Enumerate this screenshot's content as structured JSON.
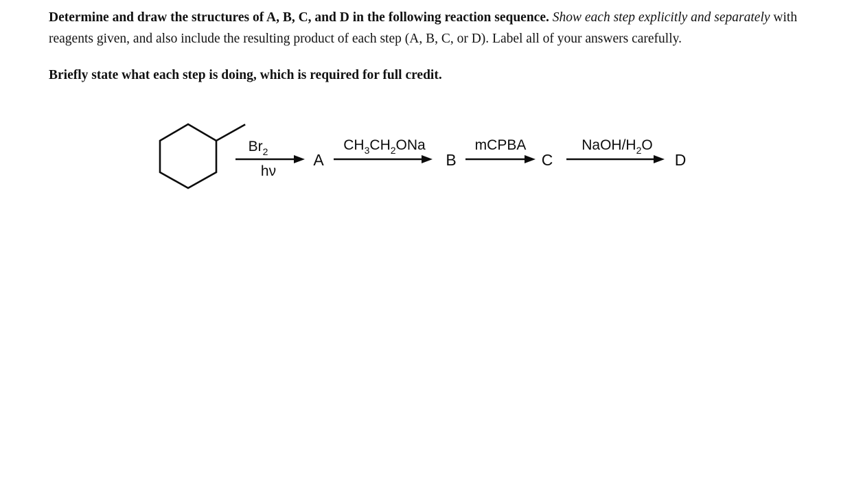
{
  "document": {
    "paragraphs": [
      {
        "id": "p1",
        "runs": [
          {
            "style": "bold",
            "text": "Determine and draw the structures of A, B, C, and D in the following reaction sequence."
          },
          {
            "style": "regular",
            "text": " "
          },
          {
            "style": "italic",
            "text": "Show each step explicitly and separately"
          },
          {
            "style": "regular",
            "text": " with reagents given, and also include the resulting product of each step (A, B, C, or D). Label all of your answers carefully."
          }
        ]
      },
      {
        "id": "p2",
        "runs": [
          {
            "style": "bold",
            "text": "Briefly state what each step is doing, which is required for full credit."
          }
        ]
      }
    ]
  },
  "scheme": {
    "structure": {
      "name": "methylcyclohexane",
      "description": "cyclohexane ring with methyl substituent"
    },
    "steps": [
      {
        "id": "step1",
        "reagent_above": "Br",
        "reagent_above_sub": "2",
        "reagent_below": "hν",
        "product_label": "A"
      },
      {
        "id": "step2",
        "reagent_above": "CH",
        "reagent_above_sub": "3",
        "reagent_above_2": "CH",
        "reagent_above_sub2": "2",
        "reagent_above_3": "ONa",
        "reagent_below": "",
        "product_label": "B"
      },
      {
        "id": "step3",
        "reagent_above": "mCPBA",
        "reagent_below": "",
        "product_label": "C"
      },
      {
        "id": "step4",
        "reagent_above": "NaOH/H",
        "reagent_above_sub": "2",
        "reagent_above_2": "O",
        "reagent_below": "",
        "product_label": "D"
      }
    ]
  },
  "colors": {
    "background": "#ffffff",
    "text": "#121212",
    "ink": "#0c0c0c"
  }
}
